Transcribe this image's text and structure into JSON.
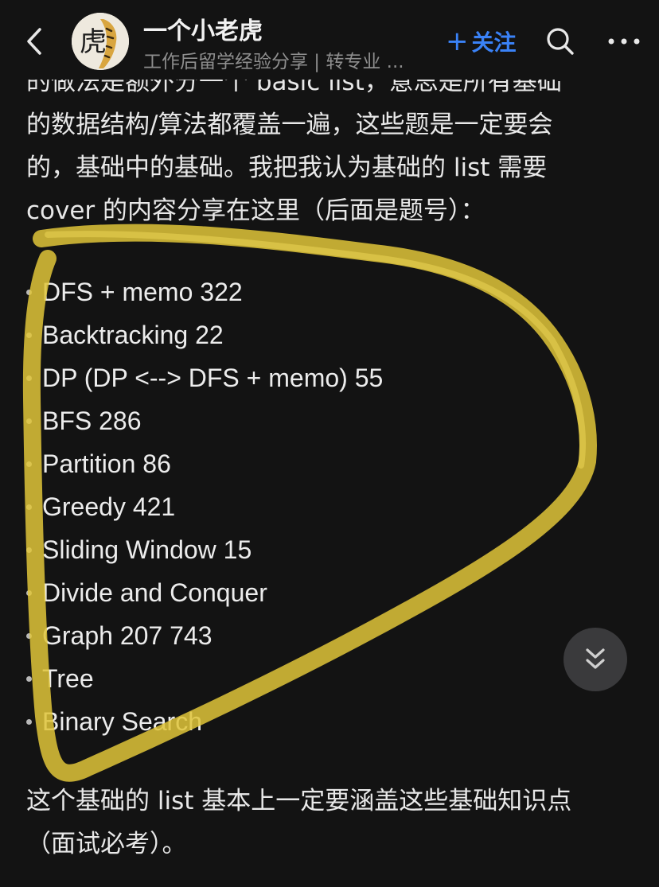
{
  "header": {
    "back_icon": "chevron-left-icon",
    "author_name": "一个小老虎",
    "author_subtitle": "工作后留学经验分享 | 转专业 ...",
    "avatar_glyph": "虎",
    "follow_label": "关注",
    "follow_plus": "+",
    "search_icon": "search-icon",
    "more_icon": "more-horizontal-icon",
    "accent_color": "#3a82f7"
  },
  "article": {
    "intro_lines": [
      "的做法是额外分一个 basic list，意思是所有基础",
      "的数据结构/算法都覆盖一遍，这些题是一定要会",
      "的，基础中的基础。我把我认为基础的 list 需要",
      "cover 的内容分享在这里（后面是题号）："
    ],
    "topics": [
      "DFS + memo 322",
      "Backtracking 22",
      "DP (DP <--> DFS + memo) 55",
      "BFS 286",
      "Partition 86",
      "Greedy 421",
      "Sliding Window 15",
      "Divide and Conquer",
      "Graph 207 743",
      "Tree",
      "Binary Search"
    ],
    "closing_lines": [
      "这个基础的 list 基本上一定要涵盖这些基础知识点",
      "（面试必考）。"
    ]
  },
  "annotation": {
    "highlight_color": "#e0c63a"
  },
  "scroll_button": {
    "icon": "double-chevron-down-icon"
  }
}
